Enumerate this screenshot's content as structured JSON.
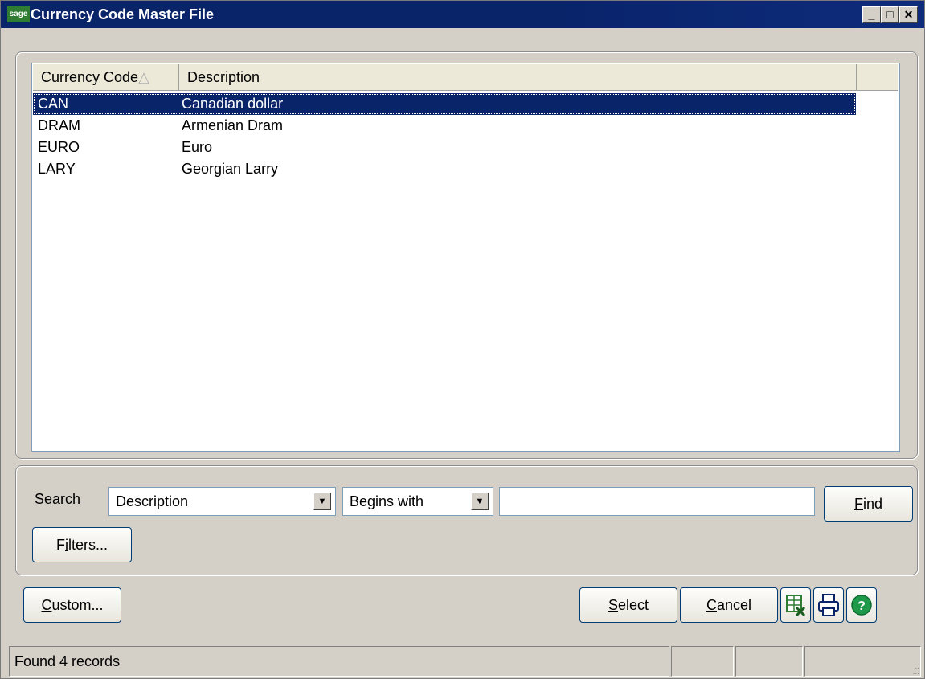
{
  "window": {
    "logo_text": "sage",
    "title": "Currency Code Master File",
    "minimize": "_",
    "maximize": "□",
    "close": "✕"
  },
  "list": {
    "columns": [
      "Currency Code",
      "Description"
    ],
    "sort_indicator": "△",
    "rows": [
      {
        "code": "CAN",
        "description": "Canadian dollar",
        "selected": true
      },
      {
        "code": "DRAM",
        "description": "Armenian Dram",
        "selected": false
      },
      {
        "code": "EURO",
        "description": "Euro",
        "selected": false
      },
      {
        "code": "LARY",
        "description": "Georgian Larry",
        "selected": false
      }
    ]
  },
  "search": {
    "label": "Search",
    "field_value": "Description",
    "operator_value": "Begins with",
    "text_value": "",
    "find_label": "Find",
    "filters_label": "Filters..."
  },
  "buttons": {
    "custom_label": "Custom...",
    "select_label": "Select",
    "cancel_label": "Cancel",
    "excel_icon": "excel-export-icon",
    "print_icon": "printer-icon",
    "help_icon": "help-icon"
  },
  "status": {
    "text": "Found 4 records"
  },
  "colors": {
    "titlebar": "#0a246a",
    "selection": "#0a246a",
    "button_border": "#003c74",
    "help_green": "#1f9a4a"
  }
}
